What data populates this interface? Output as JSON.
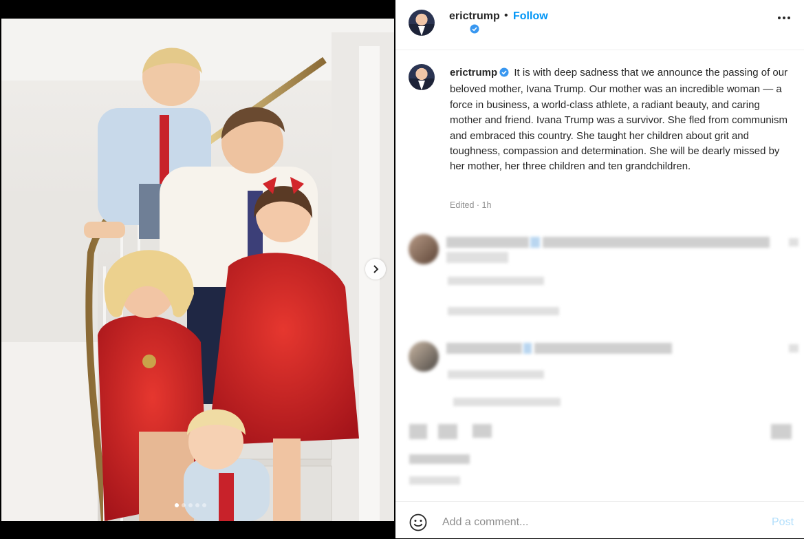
{
  "post": {
    "username": "erictrump",
    "header_separator": "•",
    "follow_label": "Follow",
    "caption": "It is with deep sadness that we announce the passing of our beloved mother, Ivana Trump. Our mother was an incredible woman — a force in business, a world-class athlete, a radiant beauty, and caring mother and friend. Ivana Trump was a survivor. She fled from communism and embraced this country. She taught her children about grit and toughness, compassion and determination. She will be dearly missed by her mother, her three children and ten grandchildren.",
    "edited_time": "Edited · 1h",
    "carousel": {
      "slide_count": 5,
      "active_index": 0
    }
  },
  "comments_blurred": true,
  "footer": {
    "comment_placeholder": "Add a comment...",
    "post_label": "Post"
  },
  "colors": {
    "accent": "#0095f6",
    "post_disabled": "#b2dffc",
    "verified": "#3897f0"
  },
  "icons": [
    "verified-badge-icon",
    "more-options-icon",
    "next-arrow-icon",
    "emoji-icon"
  ]
}
